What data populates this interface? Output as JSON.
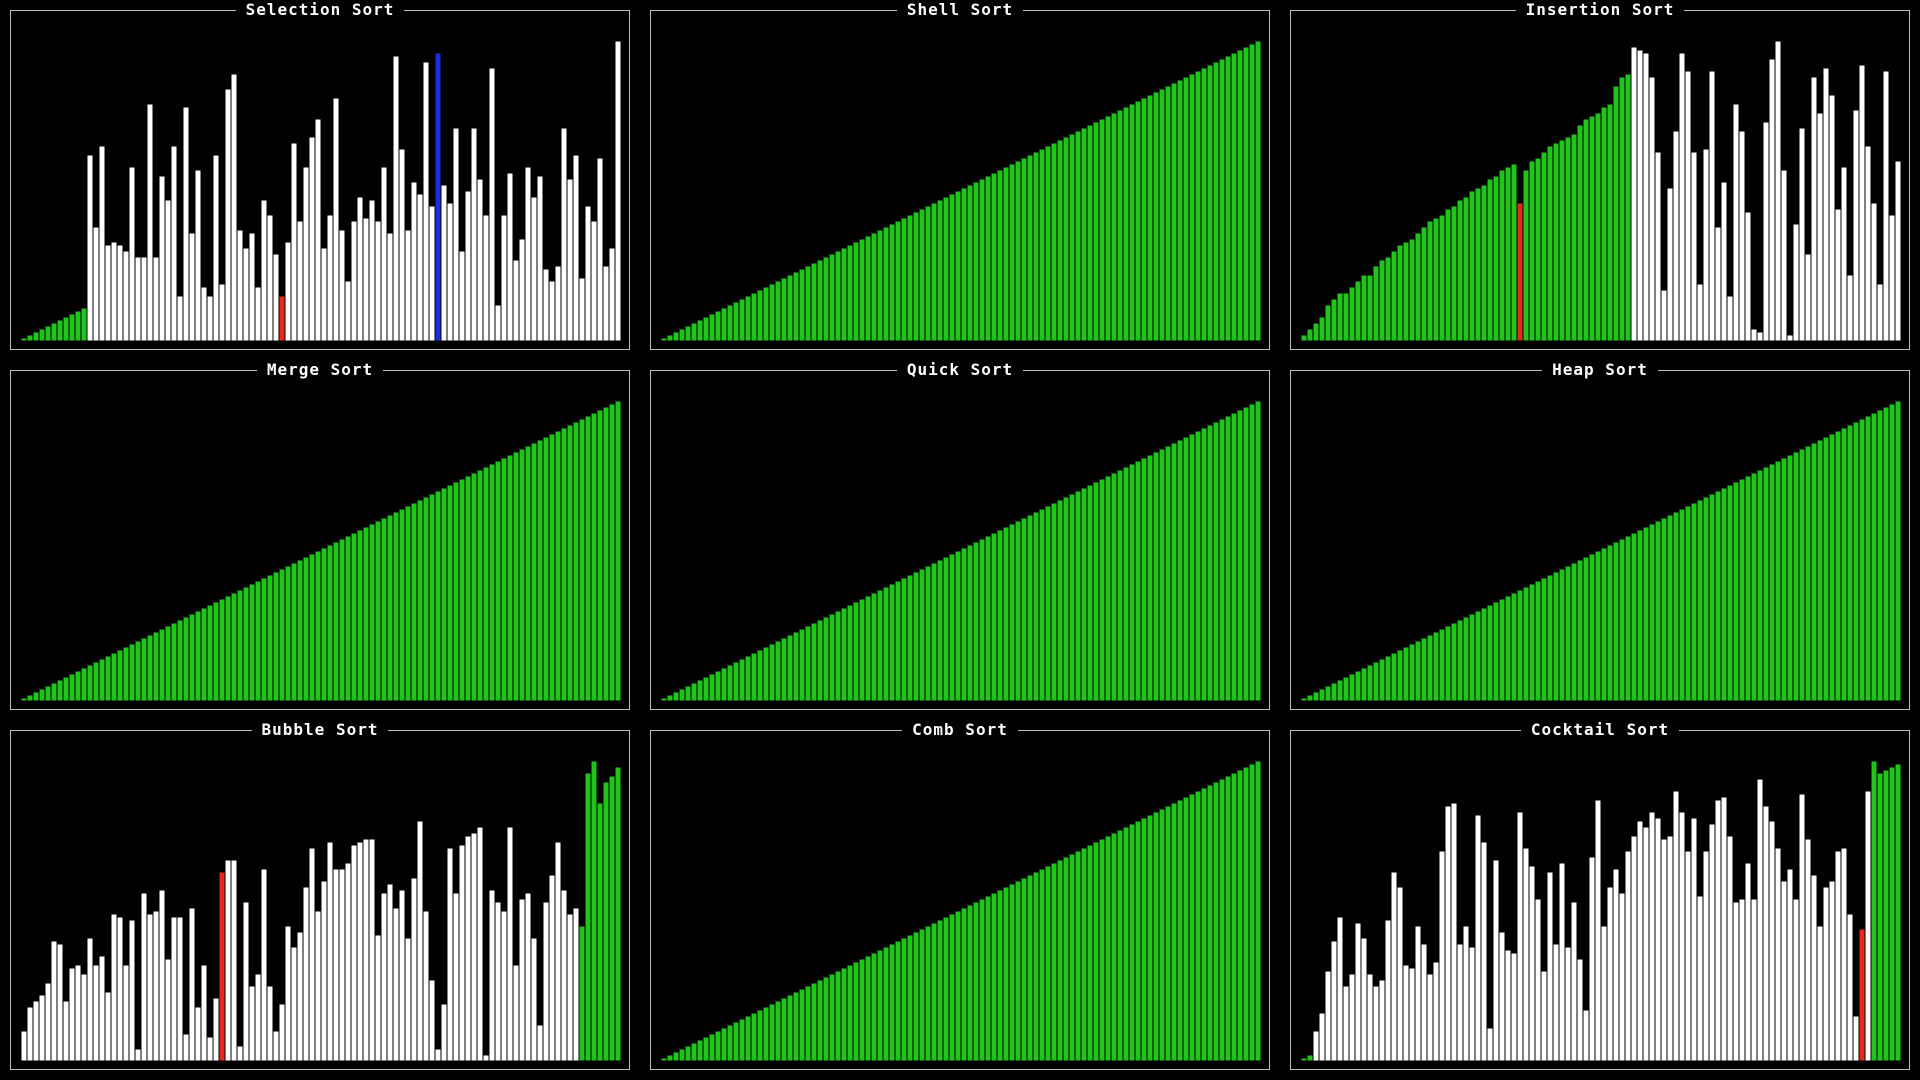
{
  "colors": {
    "background": "#000000",
    "border": "#bdbdbd",
    "title": "#ffffff",
    "unsorted": "#ffffff",
    "sorted": "#22c41c",
    "compare": "#e8281c",
    "pivot": "#1b2de0",
    "bar_outline": "#000000"
  },
  "bar_count": 100,
  "panels": [
    {
      "title": "Selection Sort",
      "state": "in-progress",
      "sorted_prefix": 11,
      "highlights": [
        {
          "index": 43,
          "role": "compare"
        },
        {
          "index": 69,
          "role": "pivot"
        }
      ],
      "values": [
        1,
        2,
        3,
        4,
        5,
        6,
        7,
        8,
        9,
        10,
        11,
        62,
        38,
        65,
        32,
        33,
        32,
        30,
        58,
        28,
        28,
        79,
        28,
        55,
        47,
        65,
        15,
        78,
        36,
        57,
        18,
        15,
        62,
        19,
        84,
        89,
        37,
        31,
        36,
        18,
        47,
        42,
        29,
        15,
        33,
        66,
        40,
        58,
        68,
        74,
        31,
        42,
        81,
        37,
        20,
        40,
        48,
        41,
        47,
        40,
        58,
        36,
        95,
        64,
        37,
        53,
        49,
        93,
        45,
        96,
        52,
        46,
        71,
        30,
        50,
        71,
        54,
        42,
        91,
        12,
        42,
        56,
        27,
        34,
        58,
        48,
        55,
        24,
        20,
        25,
        71,
        54,
        62,
        21,
        45,
        40,
        61,
        25,
        31,
        100
      ]
    },
    {
      "title": "Shell Sort",
      "state": "sorted",
      "values": [
        1,
        2,
        3,
        4,
        5,
        6,
        7,
        8,
        9,
        10,
        11,
        12,
        13,
        14,
        15,
        16,
        17,
        18,
        19,
        20,
        21,
        22,
        23,
        24,
        25,
        26,
        27,
        28,
        29,
        30,
        31,
        32,
        33,
        34,
        35,
        36,
        37,
        38,
        39,
        40,
        41,
        42,
        43,
        44,
        45,
        46,
        47,
        48,
        49,
        50,
        51,
        52,
        53,
        54,
        55,
        56,
        57,
        58,
        59,
        60,
        61,
        62,
        63,
        64,
        65,
        66,
        67,
        68,
        69,
        70,
        71,
        72,
        73,
        74,
        75,
        76,
        77,
        78,
        79,
        80,
        81,
        82,
        83,
        84,
        85,
        86,
        87,
        88,
        89,
        90,
        91,
        92,
        93,
        94,
        95,
        96,
        97,
        98,
        99,
        100
      ]
    },
    {
      "title": "Insertion Sort",
      "state": "in-progress",
      "sorted_prefix": 55,
      "highlights": [
        {
          "index": 36,
          "role": "compare"
        }
      ],
      "values": [
        2,
        4,
        6,
        8,
        12,
        14,
        16,
        16,
        18,
        20,
        22,
        22,
        25,
        27,
        28,
        30,
        32,
        33,
        34,
        36,
        38,
        40,
        41,
        42,
        44,
        45,
        47,
        48,
        50,
        51,
        52,
        54,
        55,
        57,
        58,
        59,
        46,
        57,
        60,
        61,
        63,
        65,
        66,
        67,
        68,
        69,
        72,
        74,
        75,
        76,
        78,
        79,
        85,
        88,
        89,
        98,
        97,
        96,
        88,
        63,
        17,
        51,
        70,
        96,
        90,
        63,
        19,
        64,
        90,
        38,
        53,
        15,
        79,
        70,
        43,
        4,
        3,
        73,
        94,
        100,
        57,
        2,
        39,
        71,
        29,
        88,
        76,
        91,
        82,
        44,
        58,
        22,
        77,
        92,
        65,
        46,
        19,
        90,
        42,
        60
      ]
    },
    {
      "title": "Merge Sort",
      "state": "sorted",
      "values": [
        1,
        2,
        3,
        4,
        5,
        6,
        7,
        8,
        9,
        10,
        11,
        12,
        13,
        14,
        15,
        16,
        17,
        18,
        19,
        20,
        21,
        22,
        23,
        24,
        25,
        26,
        27,
        28,
        29,
        30,
        31,
        32,
        33,
        34,
        35,
        36,
        37,
        38,
        39,
        40,
        41,
        42,
        43,
        44,
        45,
        46,
        47,
        48,
        49,
        50,
        51,
        52,
        53,
        54,
        55,
        56,
        57,
        58,
        59,
        60,
        61,
        62,
        63,
        64,
        65,
        66,
        67,
        68,
        69,
        70,
        71,
        72,
        73,
        74,
        75,
        76,
        77,
        78,
        79,
        80,
        81,
        82,
        83,
        84,
        85,
        86,
        87,
        88,
        89,
        90,
        91,
        92,
        93,
        94,
        95,
        96,
        97,
        98,
        99,
        100
      ]
    },
    {
      "title": "Quick Sort",
      "state": "sorted",
      "values": [
        1,
        2,
        3,
        4,
        5,
        6,
        7,
        8,
        9,
        10,
        11,
        12,
        13,
        14,
        15,
        16,
        17,
        18,
        19,
        20,
        21,
        22,
        23,
        24,
        25,
        26,
        27,
        28,
        29,
        30,
        31,
        32,
        33,
        34,
        35,
        36,
        37,
        38,
        39,
        40,
        41,
        42,
        43,
        44,
        45,
        46,
        47,
        48,
        49,
        50,
        51,
        52,
        53,
        54,
        55,
        56,
        57,
        58,
        59,
        60,
        61,
        62,
        63,
        64,
        65,
        66,
        67,
        68,
        69,
        70,
        71,
        72,
        73,
        74,
        75,
        76,
        77,
        78,
        79,
        80,
        81,
        82,
        83,
        84,
        85,
        86,
        87,
        88,
        89,
        90,
        91,
        92,
        93,
        94,
        95,
        96,
        97,
        98,
        99,
        100
      ]
    },
    {
      "title": "Heap Sort",
      "state": "sorted",
      "values": [
        1,
        2,
        3,
        4,
        5,
        6,
        7,
        8,
        9,
        10,
        11,
        12,
        13,
        14,
        15,
        16,
        17,
        18,
        19,
        20,
        21,
        22,
        23,
        24,
        25,
        26,
        27,
        28,
        29,
        30,
        31,
        32,
        33,
        34,
        35,
        36,
        37,
        38,
        39,
        40,
        41,
        42,
        43,
        44,
        45,
        46,
        47,
        48,
        49,
        50,
        51,
        52,
        53,
        54,
        55,
        56,
        57,
        58,
        59,
        60,
        61,
        62,
        63,
        64,
        65,
        66,
        67,
        68,
        69,
        70,
        71,
        72,
        73,
        74,
        75,
        76,
        77,
        78,
        79,
        80,
        81,
        82,
        83,
        84,
        85,
        86,
        87,
        88,
        89,
        90,
        91,
        92,
        93,
        94,
        95,
        96,
        97,
        98,
        99,
        100
      ]
    },
    {
      "title": "Bubble Sort",
      "state": "in-progress",
      "sorted_suffix": 7,
      "highlights": [
        {
          "index": 33,
          "role": "compare"
        }
      ],
      "values": [
        10,
        18,
        20,
        22,
        26,
        40,
        39,
        20,
        31,
        32,
        29,
        41,
        32,
        35,
        23,
        49,
        48,
        32,
        47,
        4,
        56,
        49,
        50,
        57,
        34,
        48,
        48,
        9,
        51,
        18,
        32,
        8,
        21,
        63,
        67,
        67,
        5,
        53,
        25,
        29,
        64,
        25,
        10,
        19,
        45,
        38,
        43,
        58,
        71,
        50,
        60,
        73,
        64,
        64,
        66,
        72,
        73,
        74,
        74,
        42,
        56,
        59,
        51,
        57,
        41,
        61,
        80,
        50,
        27,
        4,
        19,
        71,
        56,
        72,
        75,
        76,
        78,
        2,
        57,
        53,
        50,
        78,
        32,
        54,
        56,
        41,
        12,
        53,
        62,
        73,
        57,
        49,
        51,
        45,
        96,
        100,
        86,
        93,
        95,
        98
      ]
    },
    {
      "title": "Comb Sort",
      "state": "sorted",
      "values": [
        1,
        2,
        3,
        4,
        5,
        6,
        7,
        8,
        9,
        10,
        11,
        12,
        13,
        14,
        15,
        16,
        17,
        18,
        19,
        20,
        21,
        22,
        23,
        24,
        25,
        26,
        27,
        28,
        29,
        30,
        31,
        32,
        33,
        34,
        35,
        36,
        37,
        38,
        39,
        40,
        41,
        42,
        43,
        44,
        45,
        46,
        47,
        48,
        49,
        50,
        51,
        52,
        53,
        54,
        55,
        56,
        57,
        58,
        59,
        60,
        61,
        62,
        63,
        64,
        65,
        66,
        67,
        68,
        69,
        70,
        71,
        72,
        73,
        74,
        75,
        76,
        77,
        78,
        79,
        80,
        81,
        82,
        83,
        84,
        85,
        86,
        87,
        88,
        89,
        90,
        91,
        92,
        93,
        94,
        95,
        96,
        97,
        98,
        99,
        100
      ]
    },
    {
      "title": "Cocktail Sort",
      "state": "in-progress",
      "sorted_prefix": 2,
      "sorted_suffix": 5,
      "highlights": [
        {
          "index": 93,
          "role": "compare"
        }
      ],
      "values": [
        1,
        2,
        10,
        16,
        30,
        40,
        48,
        25,
        29,
        46,
        41,
        29,
        25,
        27,
        47,
        63,
        58,
        32,
        31,
        45,
        39,
        29,
        33,
        70,
        85,
        86,
        39,
        45,
        38,
        82,
        73,
        11,
        67,
        43,
        37,
        36,
        83,
        71,
        65,
        54,
        30,
        63,
        39,
        66,
        38,
        53,
        34,
        17,
        68,
        87,
        45,
        58,
        64,
        56,
        70,
        75,
        80,
        78,
        83,
        81,
        74,
        75,
        90,
        83,
        70,
        81,
        55,
        70,
        79,
        87,
        88,
        75,
        53,
        54,
        66,
        54,
        94,
        85,
        80,
        71,
        60,
        64,
        54,
        89,
        74,
        62,
        45,
        58,
        60,
        70,
        71,
        49,
        15,
        44,
        90,
        100,
        96,
        97,
        98,
        99
      ]
    }
  ]
}
